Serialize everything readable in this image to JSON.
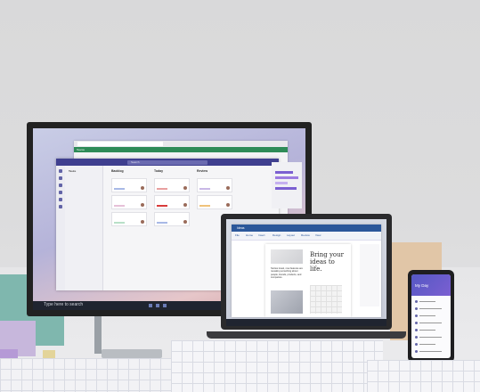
{
  "scene": {
    "description_label": ""
  },
  "monitor": {
    "browser": {
      "tabs": [
        "",
        "",
        ""
      ],
      "green_bar_label": "Teams"
    },
    "teams": {
      "app_title": "Tasks",
      "search_placeholder": "Search",
      "sidebar_items": [
        "",
        "",
        "",
        "",
        "",
        "",
        "",
        "",
        "",
        "",
        ""
      ],
      "board": {
        "columns": [
          {
            "title": "Backlog",
            "cards": [
              "",
              "",
              ""
            ]
          },
          {
            "title": "Today",
            "cards": [
              "",
              "",
              "",
              ""
            ]
          },
          {
            "title": "Review",
            "cards": [
              "",
              ""
            ]
          }
        ]
      }
    },
    "taskbar_text": "Type here to search"
  },
  "laptop": {
    "word": {
      "title": "Ideas",
      "ribbon_tabs": [
        "File",
        "Home",
        "Insert",
        "Design",
        "Layout",
        "Review",
        "View"
      ],
      "headline": "Bring your ideas to life.",
      "body": "Stories travel, now features are revealing something about people, brands, products, and companies."
    }
  },
  "phone": {
    "title": "My Day",
    "rows": 8
  },
  "colors": {
    "teams_purple": "#3f3f8f",
    "word_blue": "#2b579a",
    "browser_green": "#2e8b57"
  }
}
